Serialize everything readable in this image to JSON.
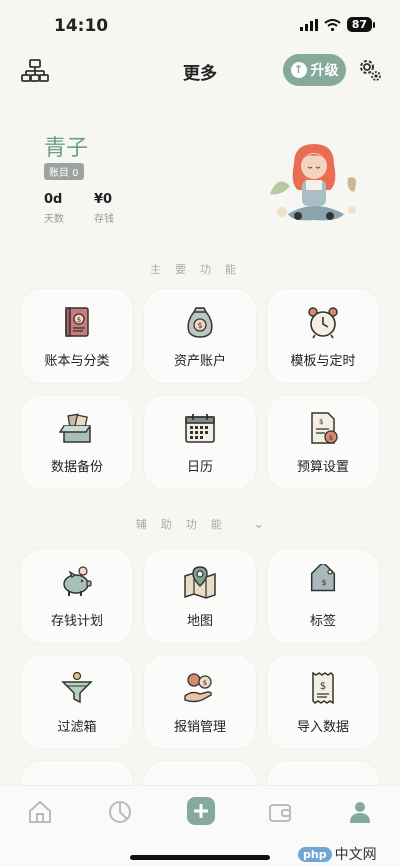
{
  "status": {
    "time": "14:10",
    "battery": "87"
  },
  "nav": {
    "title": "更多",
    "upgrade_label": "升级"
  },
  "profile": {
    "name": "青子",
    "badge": "账目 0",
    "stats": [
      {
        "value": "0d",
        "label": "天数"
      },
      {
        "value": "¥0",
        "label": "存钱"
      }
    ]
  },
  "main_section": {
    "title": "主要功能",
    "items": [
      {
        "label": "账本与分类",
        "icon": "ledger-book-icon"
      },
      {
        "label": "资产账户",
        "icon": "money-bag-icon"
      },
      {
        "label": "模板与定时",
        "icon": "alarm-clock-icon"
      },
      {
        "label": "数据备份",
        "icon": "backup-box-icon"
      },
      {
        "label": "日历",
        "icon": "calendar-icon"
      },
      {
        "label": "预算设置",
        "icon": "budget-document-icon"
      }
    ]
  },
  "aux_section": {
    "title": "辅助功能",
    "items": [
      {
        "label": "存钱计划",
        "icon": "piggy-bank-icon"
      },
      {
        "label": "地图",
        "icon": "map-icon"
      },
      {
        "label": "标签",
        "icon": "price-tag-icon"
      },
      {
        "label": "过滤箱",
        "icon": "filter-funnel-icon"
      },
      {
        "label": "报销管理",
        "icon": "reimbursement-hand-icon"
      },
      {
        "label": "导入数据",
        "icon": "receipt-import-icon"
      }
    ]
  },
  "tabs": [
    {
      "name": "home-tab-icon"
    },
    {
      "name": "chart-tab-icon"
    },
    {
      "name": "add-tab-icon"
    },
    {
      "name": "wallet-tab-icon"
    },
    {
      "name": "profile-tab-icon"
    }
  ],
  "watermark": {
    "logo": "php",
    "text": "中文网"
  },
  "colors": {
    "accent": "#85a99a",
    "name": "#6b9e8b"
  }
}
